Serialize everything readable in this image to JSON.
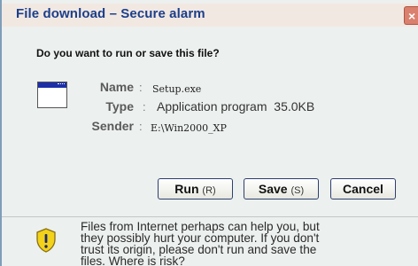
{
  "dialog": {
    "title": "File download – Secure alarm",
    "close_glyph": "×",
    "question": "Do you want to run or save this file?",
    "file_icon": "application-window-icon",
    "fields": {
      "name_label": "Name",
      "name_value": "Setup.exe",
      "type_label": "Type",
      "type_value": "Application program  35.0KB",
      "sender_label": "Sender",
      "sender_value": "E:\\Win2000_XP"
    },
    "buttons": {
      "run_label": "Run",
      "run_accel": "(R)",
      "save_label": "Save",
      "save_accel": "(S)",
      "cancel_label": "Cancel"
    },
    "warning_icon": "shield-warning-icon",
    "warning_text": "Files from Internet perhaps can help you, but\nthey possibly hurt your computer. If you don't\ntrust its origin, please don't run and save the\nfiles. Where is risk?"
  },
  "colors": {
    "title_text": "#1b3f8b",
    "titlebar_bg": "#f2e8e2",
    "dialog_bg": "#ecf0ee",
    "shield_yellow": "#f2d21a"
  }
}
